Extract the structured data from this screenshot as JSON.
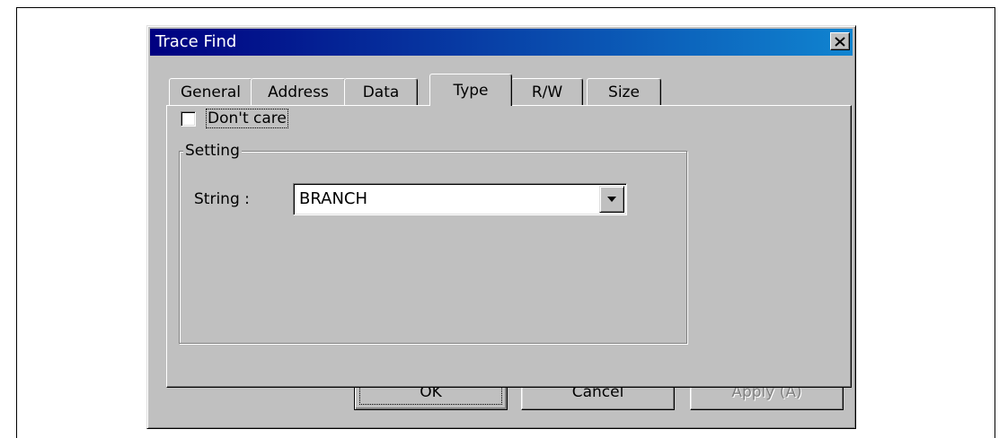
{
  "dialog": {
    "title": "Trace Find",
    "close_glyph": "✕"
  },
  "tabs": [
    {
      "label": "General"
    },
    {
      "label": "Address"
    },
    {
      "label": "Data"
    },
    {
      "label": "Type",
      "active": true
    },
    {
      "label": "R/W"
    },
    {
      "label": "Size"
    }
  ],
  "panel": {
    "dont_care": {
      "label": "Don't care",
      "checked": false
    },
    "setting_group": {
      "legend": "Setting",
      "string_label": "String :",
      "string_value": "BRANCH"
    }
  },
  "buttons": {
    "ok": "OK",
    "cancel": "Cancel",
    "apply": "Apply (A)"
  },
  "colors": {
    "dialog_face": "#c0c0c0",
    "title_start": "#000080",
    "title_end": "#1084d0",
    "disabled_text": "#808080"
  }
}
